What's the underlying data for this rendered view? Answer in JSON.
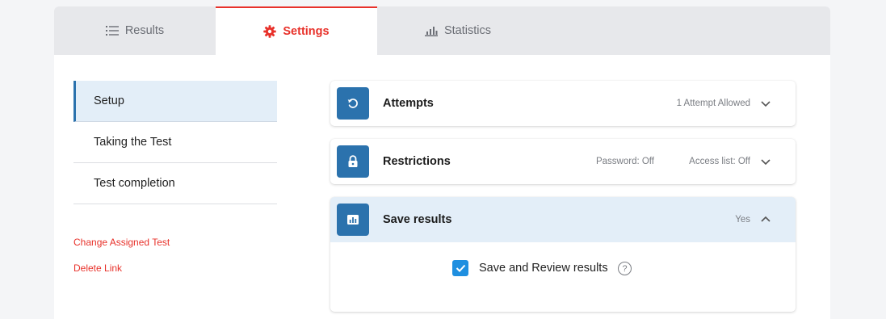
{
  "tabs": [
    {
      "label": "Results",
      "icon": "list-icon"
    },
    {
      "label": "Settings",
      "icon": "gear-icon"
    },
    {
      "label": "Statistics",
      "icon": "bar-chart-icon"
    }
  ],
  "colors": {
    "accent": "#e8312a",
    "primary": "#2b72ad",
    "checkbox": "#1f8fe0",
    "active_bg": "#e3eef8"
  },
  "sidebar": {
    "items": [
      {
        "label": "Setup"
      },
      {
        "label": "Taking the Test"
      },
      {
        "label": "Test completion"
      }
    ],
    "links": [
      {
        "label": "Change Assigned Test"
      },
      {
        "label": "Delete Link"
      }
    ]
  },
  "cards": {
    "attempts": {
      "title": "Attempts",
      "icon": "refresh-icon",
      "summary": "1 Attempt Allowed"
    },
    "restrictions": {
      "title": "Restrictions",
      "icon": "lock-icon",
      "password": "Password: Off",
      "access": "Access list: Off"
    },
    "save_results": {
      "title": "Save results",
      "icon": "chart-icon",
      "summary": "Yes",
      "checkbox_label": "Save and Review results",
      "checked": true,
      "help": "?"
    }
  }
}
